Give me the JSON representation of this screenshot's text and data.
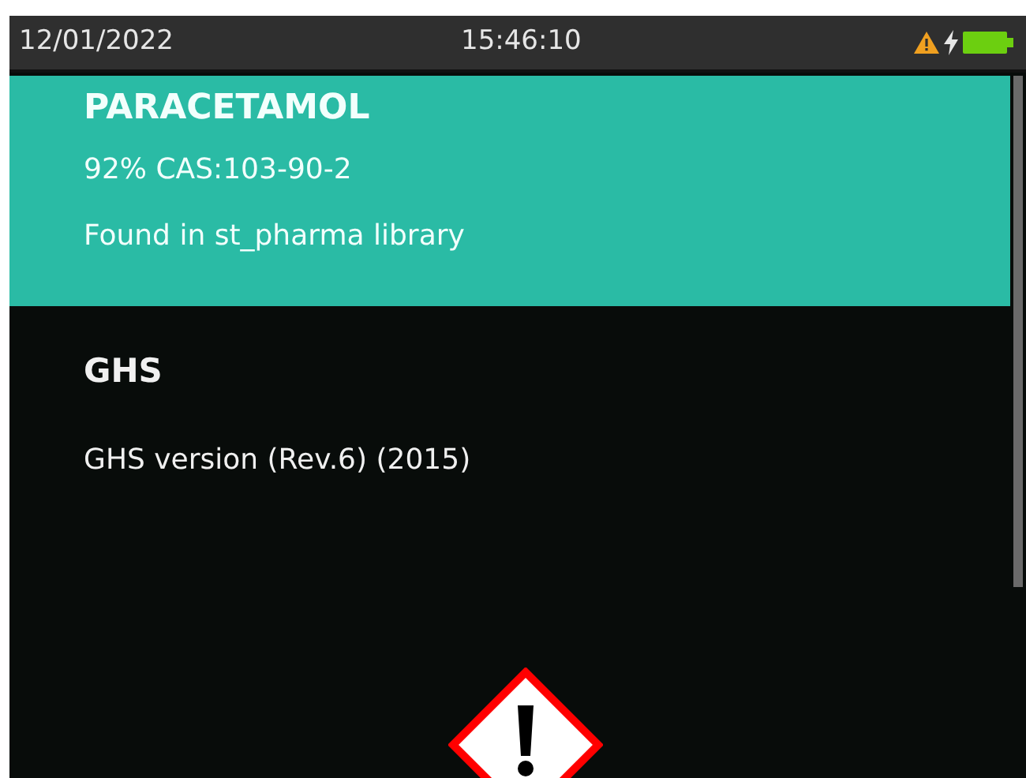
{
  "status_bar": {
    "date": "12/01/2022",
    "time": "15:46:10",
    "warning": true,
    "charging": true
  },
  "result": {
    "name": "PARACETAMOL",
    "match": "92% CAS:103-90-2",
    "source": "Found in st_pharma library"
  },
  "ghs": {
    "heading": "GHS",
    "version": "GHS version (Rev.6) (2015)"
  }
}
